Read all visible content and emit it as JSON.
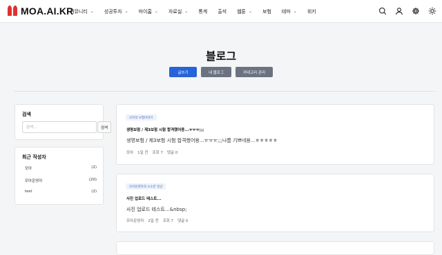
{
  "header": {
    "logo_text": "MOA.AI.KR",
    "nav": [
      {
        "label": "커뮤니티",
        "dropdown": true
      },
      {
        "label": "성공투자",
        "dropdown": true
      },
      {
        "label": "마이홈",
        "dropdown": true
      },
      {
        "label": "자료실",
        "dropdown": true
      },
      {
        "label": "통계",
        "dropdown": false
      },
      {
        "label": "출석",
        "dropdown": false
      },
      {
        "label": "웹툰",
        "dropdown": true
      },
      {
        "label": "보험",
        "dropdown": false
      },
      {
        "label": "테마",
        "dropdown": true
      },
      {
        "label": "위키",
        "dropdown": false
      }
    ],
    "icons": [
      "search-icon",
      "user-icon",
      "gear-icon",
      "sun-icon"
    ]
  },
  "page": {
    "title": "블로그",
    "buttons": {
      "write": "글쓰기",
      "my_blog": "내 블로그",
      "category_manage": "카테고리 관리"
    }
  },
  "sidebar": {
    "search": {
      "title": "검색",
      "placeholder": "검색...",
      "button": "검색"
    },
    "writers": {
      "title": "최근 작성자",
      "items": [
        {
          "name": "모아",
          "count": "(2)"
        },
        {
          "name": "모아운영자",
          "count": "(20)"
        },
        {
          "name": "test",
          "count": "(2)"
        }
      ]
    }
  },
  "posts": [
    {
      "category": "모아의 보험이야기",
      "title": "생명보험 / 제3보험 시험 합격했어용...ㅠㅠㅠ;;;",
      "excerpt": "생명보험 / 제3보험 시험 합격했어용...ㅠㅠㅠ;;;나름 기쁘네용...ㅎㅎㅎㅎㅎ",
      "author": "모아",
      "time": "1일 전",
      "views": "조회 7",
      "comments": "댓글 0"
    },
    {
      "category": "모아운영자의 소소한 일상",
      "title": "사진 업로드 테스트...",
      "excerpt": "사진 업로드 테스트...&nbsp;",
      "author": "모아운영자",
      "time": "2일 전",
      "views": "조회 7",
      "comments": "댓글 0"
    }
  ]
}
